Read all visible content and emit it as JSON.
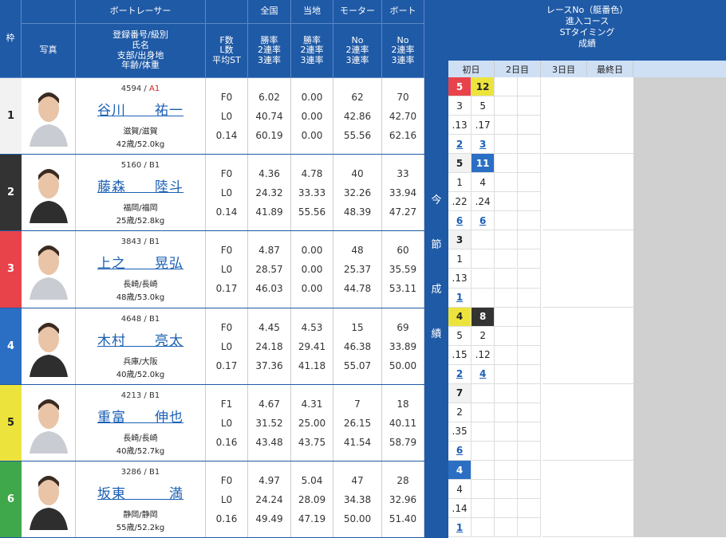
{
  "header": {
    "racer": "ボートレーサー",
    "nation": "全国",
    "local": "当地",
    "motor": "モーター",
    "boat": "ボート",
    "right_title": [
      "レースNo（艇番色）",
      "進入コース",
      "STタイミング",
      "成績"
    ],
    "waku": "枠",
    "photo": "写真",
    "info": [
      "登録番号/級別",
      "氏名",
      "支部/出身地",
      "年齢/体重"
    ],
    "fl": [
      "F数",
      "L数",
      "平均ST"
    ],
    "rate": [
      "勝率",
      "2連率",
      "3連率"
    ],
    "no": [
      "No",
      "2連率",
      "3連率"
    ],
    "days": [
      "初日",
      "2日目",
      "3日目",
      "最終日"
    ],
    "konsetsu": [
      "今",
      "節",
      "成",
      "績"
    ]
  },
  "colors": {
    "w1": "#f2f2f2",
    "w2": "#333333",
    "w3": "#e8434a",
    "w4": "#2b6fc4",
    "w5": "#ece43c",
    "w6": "#3fa84a"
  },
  "racers": [
    {
      "waku": "1",
      "id": "4594",
      "cls": "A1",
      "name": "谷川　　祐一",
      "branch": "滋賀/滋賀",
      "age": "42歳/52.0kg",
      "f": "F0",
      "l": "L0",
      "st": "0.14",
      "n1": "6.02",
      "n2": "40.74",
      "n3": "60.19",
      "l1": "0.00",
      "l2": "0.00",
      "l3": "0.00",
      "m1": "62",
      "m2": "42.86",
      "m3": "55.56",
      "b1": "70",
      "b2": "42.70",
      "b3": "62.16"
    },
    {
      "waku": "2",
      "id": "5160",
      "cls": "B1",
      "name": "藤森　　陸斗",
      "branch": "福岡/福岡",
      "age": "25歳/52.8kg",
      "f": "F0",
      "l": "L0",
      "st": "0.14",
      "n1": "4.36",
      "n2": "24.32",
      "n3": "41.89",
      "l1": "4.78",
      "l2": "33.33",
      "l3": "55.56",
      "m1": "40",
      "m2": "32.26",
      "m3": "48.39",
      "b1": "33",
      "b2": "33.94",
      "b3": "47.27"
    },
    {
      "waku": "3",
      "id": "3843",
      "cls": "B1",
      "name": "上之　　晃弘",
      "branch": "長崎/長崎",
      "age": "48歳/53.0kg",
      "f": "F0",
      "l": "L0",
      "st": "0.17",
      "n1": "4.87",
      "n2": "28.57",
      "n3": "46.03",
      "l1": "0.00",
      "l2": "0.00",
      "l3": "0.00",
      "m1": "48",
      "m2": "25.37",
      "m3": "44.78",
      "b1": "60",
      "b2": "35.59",
      "b3": "53.11"
    },
    {
      "waku": "4",
      "id": "4648",
      "cls": "B1",
      "name": "木村　　亮太",
      "branch": "兵庫/大阪",
      "age": "40歳/52.0kg",
      "f": "F0",
      "l": "L0",
      "st": "0.17",
      "n1": "4.45",
      "n2": "24.18",
      "n3": "37.36",
      "l1": "4.53",
      "l2": "29.41",
      "l3": "41.18",
      "m1": "15",
      "m2": "46.38",
      "m3": "55.07",
      "b1": "69",
      "b2": "33.89",
      "b3": "50.00"
    },
    {
      "waku": "5",
      "id": "4213",
      "cls": "B1",
      "name": "重富　　伸也",
      "branch": "長崎/長崎",
      "age": "40歳/52.7kg",
      "f": "F1",
      "l": "L0",
      "st": "0.16",
      "n1": "4.67",
      "n2": "31.52",
      "n3": "43.48",
      "l1": "4.31",
      "l2": "25.00",
      "l3": "43.75",
      "m1": "7",
      "m2": "26.15",
      "m3": "41.54",
      "b1": "18",
      "b2": "40.11",
      "b3": "58.79"
    },
    {
      "waku": "6",
      "id": "3286",
      "cls": "B1",
      "name": "坂東　　　満",
      "branch": "静岡/静岡",
      "age": "55歳/52.2kg",
      "f": "F0",
      "l": "L0",
      "st": "0.16",
      "n1": "4.97",
      "n2": "24.24",
      "n3": "49.49",
      "l1": "5.04",
      "l2": "28.09",
      "l3": "47.19",
      "m1": "47",
      "m2": "34.38",
      "m3": "50.00",
      "b1": "28",
      "b2": "32.96",
      "b3": "51.40"
    }
  ],
  "results": [
    [
      {
        "race": "5",
        "rc": "w3",
        "course": "3",
        "st": ".13",
        "rank": "2"
      },
      {
        "race": "12",
        "rc": "w5",
        "course": "5",
        "st": ".17",
        "rank": "3"
      }
    ],
    [
      {
        "race": "5",
        "rc": "w1",
        "course": "1",
        "st": ".22",
        "rank": "6"
      },
      {
        "race": "11",
        "rc": "w4",
        "course": "4",
        "st": ".24",
        "rank": "6"
      }
    ],
    [
      {
        "race": "3",
        "rc": "w1",
        "course": "1",
        "st": ".13",
        "rank": "1"
      }
    ],
    [
      {
        "race": "4",
        "rc": "w5",
        "course": "5",
        "st": ".15",
        "rank": "2"
      },
      {
        "race": "8",
        "rc": "w2",
        "course": "2",
        "st": ".12",
        "rank": "4"
      }
    ],
    [
      {
        "race": "7",
        "rc": "w1",
        "course": "2",
        "st": ".35",
        "rank": "6"
      }
    ],
    [
      {
        "race": "4",
        "rc": "w4",
        "course": "4",
        "st": ".14",
        "rank": "1"
      }
    ]
  ]
}
